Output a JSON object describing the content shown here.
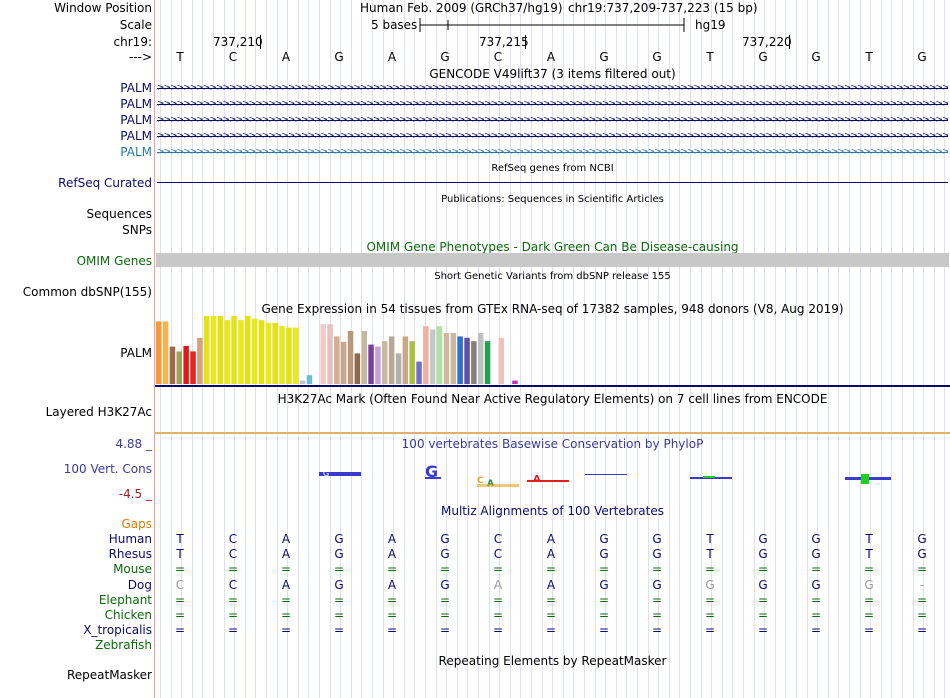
{
  "header": {
    "window_position_label": "Window Position",
    "scale_label": "Scale",
    "chrom_label": "chr19:",
    "strand_label": "--->",
    "assembly": "Human Feb. 2009 (GRCh37/hg19)",
    "position": "chr19:737,209-737,223 (15 bp)",
    "scale_text": "5 bases",
    "db": "hg19",
    "ticks": [
      "737,210",
      "737,215",
      "737,220"
    ]
  },
  "bases": [
    "T",
    "C",
    "A",
    "G",
    "A",
    "G",
    "C",
    "A",
    "G",
    "G",
    "T",
    "G",
    "G",
    "T",
    "G"
  ],
  "gencode": {
    "title": "GENCODE V49lift37 (3 items filtered out)",
    "rows": [
      "PALM",
      "PALM",
      "PALM",
      "PALM",
      "PALM"
    ]
  },
  "refseq": {
    "title": "RefSeq genes from NCBI",
    "label": "RefSeq Curated"
  },
  "publications": {
    "title": "Publications: Sequences in Scientific Articles",
    "label1": "Sequences",
    "label2": "SNPs"
  },
  "omim": {
    "title": "OMIM Gene Phenotypes - Dark Green Can Be Disease-causing",
    "label": "OMIM Genes"
  },
  "dbsnp": {
    "title": "Short Genetic Variants from dbSNP release 155",
    "label": "Common dbSNP(155)"
  },
  "gtex": {
    "title": "Gene Expression in 54 tissues from GTEx RNA-seq of 17382 samples, 948 donors (V8, Aug 2019)",
    "label": "PALM",
    "bars": [
      {
        "v": 0.92,
        "c": "#f59a3a"
      },
      {
        "v": 0.92,
        "c": "#f7b252"
      },
      {
        "v": 0.55,
        "c": "#9b6a4a"
      },
      {
        "v": 0.48,
        "c": "#a0a05a"
      },
      {
        "v": 0.56,
        "c": "#e01a1a"
      },
      {
        "v": 0.48,
        "c": "#e0251f"
      },
      {
        "v": 0.68,
        "c": "#d8a080"
      },
      {
        "v": 1.0,
        "c": "#e3e314"
      },
      {
        "v": 1.0,
        "c": "#e8e81a"
      },
      {
        "v": 1.0,
        "c": "#e3e314"
      },
      {
        "v": 0.94,
        "c": "#e8e81a"
      },
      {
        "v": 1.0,
        "c": "#e3e314"
      },
      {
        "v": 0.94,
        "c": "#e8e81a"
      },
      {
        "v": 1.0,
        "c": "#e3e314"
      },
      {
        "v": 0.96,
        "c": "#e8e81a"
      },
      {
        "v": 0.94,
        "c": "#e3e314"
      },
      {
        "v": 0.9,
        "c": "#e8e81a"
      },
      {
        "v": 0.9,
        "c": "#e3e314"
      },
      {
        "v": 0.85,
        "c": "#e8e81a"
      },
      {
        "v": 0.83,
        "c": "#e3e314"
      },
      {
        "v": 0.83,
        "c": "#e8e81a"
      },
      {
        "v": 0.05,
        "c": "#c0c0d8"
      },
      {
        "v": 0.13,
        "c": "#6ac0d0"
      },
      {
        "v": 0.0,
        "c": "#ffffff"
      },
      {
        "v": 0.88,
        "c": "#f2c8c8"
      },
      {
        "v": 0.88,
        "c": "#e8c0c0"
      },
      {
        "v": 0.7,
        "c": "#d0b090"
      },
      {
        "v": 0.62,
        "c": "#c8a888"
      },
      {
        "v": 0.78,
        "c": "#b89878"
      },
      {
        "v": 0.45,
        "c": "#8a6a4a"
      },
      {
        "v": 0.78,
        "c": "#c8b8a0"
      },
      {
        "v": 0.58,
        "c": "#7a40a0"
      },
      {
        "v": 0.55,
        "c": "#c8a0d8"
      },
      {
        "v": 0.63,
        "c": "#c8b8a0"
      },
      {
        "v": 0.7,
        "c": "#b8a898"
      },
      {
        "v": 0.45,
        "c": "#b0b0b0"
      },
      {
        "v": 0.7,
        "c": "#c8a888"
      },
      {
        "v": 0.63,
        "c": "#a8c040"
      },
      {
        "v": 0.33,
        "c": "#7070c8"
      },
      {
        "v": 0.85,
        "c": "#f0b0a0"
      },
      {
        "v": 0.8,
        "c": "#c8c8c8"
      },
      {
        "v": 0.85,
        "c": "#b0e0a0"
      },
      {
        "v": 0.75,
        "c": "#d0b8a0"
      },
      {
        "v": 0.75,
        "c": "#c8b8a0"
      },
      {
        "v": 0.7,
        "c": "#3070d0"
      },
      {
        "v": 0.68,
        "c": "#6050a0"
      },
      {
        "v": 0.63,
        "c": "#808080"
      },
      {
        "v": 0.75,
        "c": "#c0c0c0"
      },
      {
        "v": 0.63,
        "c": "#20a050"
      },
      {
        "v": 0.0,
        "c": "#ffffff"
      },
      {
        "v": 0.68,
        "c": "#f0c0c0"
      },
      {
        "v": 0.0,
        "c": "#ffffff"
      },
      {
        "v": 0.05,
        "c": "#c030c0"
      }
    ]
  },
  "h3k27ac": {
    "title": "H3K27Ac Mark (Often Found Near Active Regulatory Elements) on 7 cell lines from ENCODE",
    "label": "Layered H3K27Ac"
  },
  "phylop": {
    "title": "100 vertebrates Basewise Conservation by PhyloP",
    "label": "100 Vert. Cons",
    "max": "4.88 _",
    "min": "-4.5 _"
  },
  "multiz": {
    "title": "Multiz Alignments of 100 Vertebrates",
    "gaps_label": "Gaps",
    "species": [
      {
        "name": "Human",
        "color": "#0b0b6a",
        "seq": [
          "T",
          "C",
          "A",
          "G",
          "A",
          "G",
          "C",
          "A",
          "G",
          "G",
          "T",
          "G",
          "G",
          "T",
          "G"
        ],
        "gray": []
      },
      {
        "name": "Rhesus",
        "color": "#0b0b6a",
        "seq": [
          "T",
          "C",
          "A",
          "G",
          "A",
          "G",
          "C",
          "A",
          "G",
          "G",
          "T",
          "G",
          "G",
          "T",
          "G"
        ],
        "gray": []
      },
      {
        "name": "Mouse",
        "color": "#0b6a0b",
        "seq": [
          "=",
          "=",
          "=",
          "=",
          "=",
          "=",
          "=",
          "=",
          "=",
          "=",
          "=",
          "=",
          "=",
          "=",
          "="
        ],
        "gray": []
      },
      {
        "name": "Dog",
        "color": "#0b0b6a",
        "seq": [
          "C",
          "C",
          "A",
          "G",
          "A",
          "G",
          "A",
          "A",
          "G",
          "G",
          "G",
          "G",
          "G",
          "G",
          "-"
        ],
        "gray": [
          0,
          6,
          10,
          13,
          14
        ]
      },
      {
        "name": "Elephant",
        "color": "#0b6a0b",
        "seq": [
          "=",
          "=",
          "=",
          "=",
          "=",
          "=",
          "=",
          "=",
          "=",
          "=",
          "=",
          "=",
          "=",
          "=",
          "="
        ],
        "gray": []
      },
      {
        "name": "Chicken",
        "color": "#0b6a0b",
        "seq": [
          "=",
          "=",
          "=",
          "=",
          "=",
          "=",
          "=",
          "=",
          "=",
          "=",
          "=",
          "=",
          "=",
          "=",
          "="
        ],
        "gray": []
      },
      {
        "name": "X_tropicalis",
        "color": "#0b0b6a",
        "seq": [
          "=",
          "=",
          "=",
          "=",
          "=",
          "=",
          "=",
          "=",
          "=",
          "=",
          "=",
          "=",
          "=",
          "=",
          "="
        ],
        "gray": []
      },
      {
        "name": "Zebrafish",
        "color": "#0b6a0b",
        "seq": [],
        "gray": []
      }
    ]
  },
  "repeatmasker": {
    "title": "Repeating Elements by RepeatMasker",
    "label": "RepeatMasker"
  }
}
